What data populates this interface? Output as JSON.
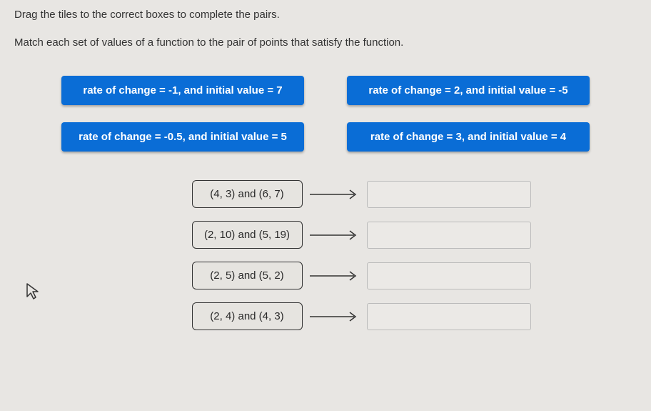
{
  "instructions": {
    "line1": "Drag the tiles to the correct boxes to complete the pairs.",
    "line2": "Match each set of values of a function to the pair of points that satisfy the function."
  },
  "tiles": [
    "rate of change = -1, and initial value = 7",
    "rate of change = 2, and initial value = -5",
    "rate of change = -0.5, and initial value = 5",
    "rate of change = 3, and initial value = 4"
  ],
  "prompts": [
    "(4, 3) and (6, 7)",
    "(2, 10) and (5, 19)",
    "(2, 5) and (5, 2)",
    "(2, 4) and (4, 3)"
  ],
  "colors": {
    "tile_bg": "#0a6dd6",
    "page_bg": "#e8e6e3"
  }
}
